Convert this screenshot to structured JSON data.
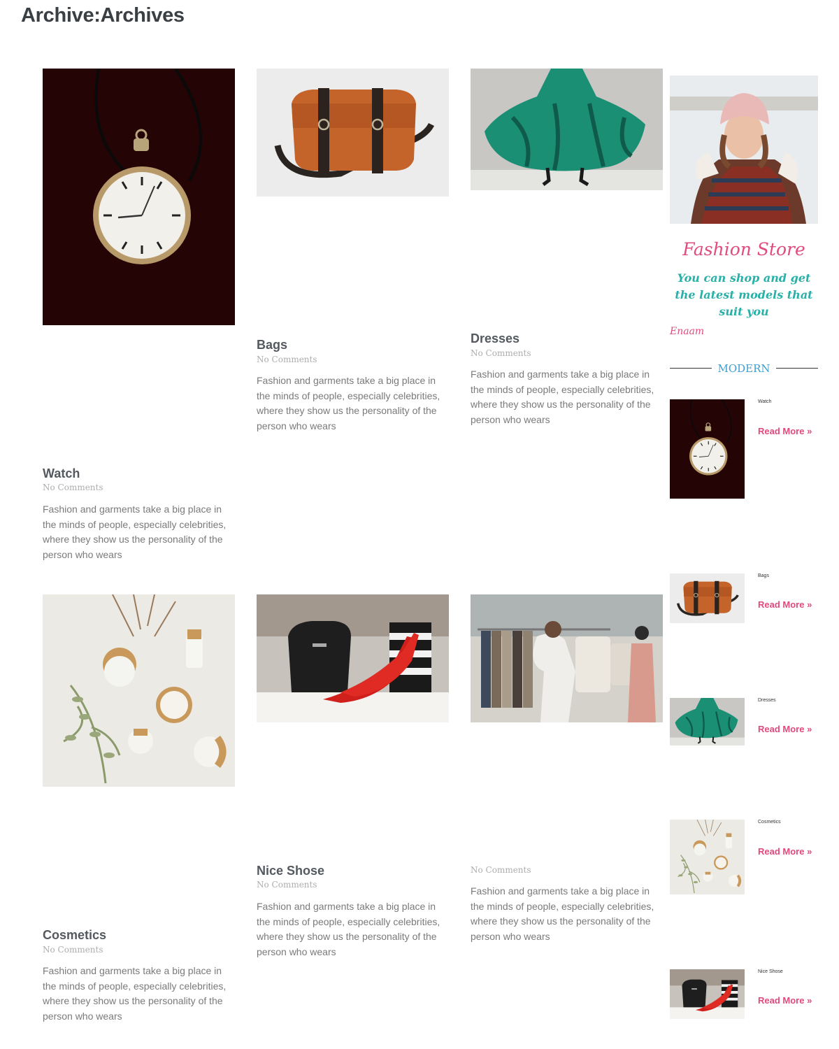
{
  "page": {
    "title": "Archive:Archives"
  },
  "posts": [
    {
      "title": "Watch",
      "meta": "No Comments",
      "excerpt": "Fashion and garments take a big place in the minds of people, especially celebrities, where they show us the personality of the person who wears",
      "image": "pocket-watch"
    },
    {
      "title": "Bags",
      "meta": "No Comments",
      "excerpt": "Fashion and garments take a big place in the minds of people, especially celebrities, where they show us the personality of the person who wears",
      "image": "leather-bag"
    },
    {
      "title": "Dresses",
      "meta": "No Comments",
      "excerpt": "Fashion and garments take a big place in the minds of people, especially celebrities, where they show us the personality of the person who wears",
      "image": "green-dress"
    },
    {
      "title": "Cosmetics",
      "meta": "No Comments",
      "excerpt": "Fashion and garments take a big place in the minds of people, especially celebrities, where they show us the personality of the person who wears",
      "image": "cosmetics-jars"
    },
    {
      "title": "Nice Shose",
      "meta": "No Comments",
      "excerpt": "Fashion and garments take a big place in the minds of people, especially celebrities, where they show us the personality of the person who wears",
      "image": "red-heels"
    },
    {
      "title": "",
      "meta": "No Comments",
      "excerpt": "Fashion and garments take a big place in the minds of people, especially celebrities, where they show us the personality of the person who wears",
      "image": "clothes-shop"
    }
  ],
  "sidebar": {
    "promo": {
      "title": "Fashion Store",
      "text": "You can shop and get the latest models that suit you",
      "signature": "Enaam",
      "image": "woman-in-winter-coat"
    },
    "section_label": "MODERN",
    "items": [
      {
        "title": "Watch",
        "read_more": "Read More »",
        "image": "pocket-watch"
      },
      {
        "title": "Bags",
        "read_more": "Read More »",
        "image": "leather-bag"
      },
      {
        "title": "Dresses",
        "read_more": "Read More »",
        "image": "green-dress"
      },
      {
        "title": "Cosmetics",
        "read_more": "Read More »",
        "image": "cosmetics-jars"
      },
      {
        "title": "Nice Shose",
        "read_more": "Read More »",
        "image": "red-heels"
      }
    ]
  },
  "colors": {
    "accent": "#e2497c",
    "teal": "#29b0a8",
    "blue": "#3d9fd1",
    "heading": "#54595f",
    "text": "#7a7a7a"
  }
}
